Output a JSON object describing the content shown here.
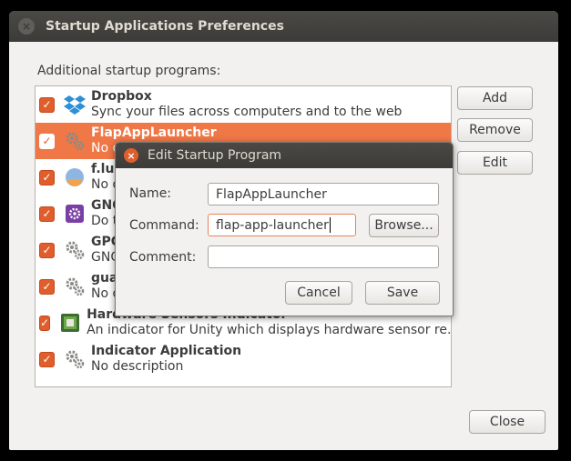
{
  "window": {
    "title": "Startup Applications Preferences",
    "close_glyph": "×"
  },
  "section_label": "Additional startup programs:",
  "list": {
    "items": [
      {
        "name": "Dropbox",
        "desc": "Sync your files across computers and to the web",
        "icon": "dropbox-icon",
        "checked": true
      },
      {
        "name": "FlapAppLauncher",
        "desc": "No d",
        "icon": "gear-icon",
        "checked": true,
        "selected": true
      },
      {
        "name": "f.lux",
        "desc": "No d",
        "icon": "flux-icon",
        "checked": true
      },
      {
        "name": "GNO",
        "desc": "Do th",
        "icon": "purple-gear-icon",
        "checked": true
      },
      {
        "name": "GPG",
        "desc": "GNO",
        "icon": "gear-icon",
        "checked": true
      },
      {
        "name": "guak",
        "desc": "No d",
        "icon": "gear-icon",
        "checked": true
      },
      {
        "name": "Hardware Sensors Indicator",
        "desc": "An indicator for Unity which displays hardware sensor re...",
        "icon": "sensor-icon",
        "checked": true
      },
      {
        "name": "Indicator Application",
        "desc": "No description",
        "icon": "gear-icon",
        "checked": true
      }
    ]
  },
  "buttons": {
    "add": "Add",
    "remove": "Remove",
    "edit": "Edit",
    "close": "Close"
  },
  "dialog": {
    "title": "Edit Startup Program",
    "close_glyph": "×",
    "name_label": "Name:",
    "name_value": "FlapAppLauncher",
    "command_label": "Command:",
    "command_value": "flap-app-launcher",
    "comment_label": "Comment:",
    "comment_value": "",
    "browse_label": "Browse...",
    "cancel_label": "Cancel",
    "save_label": "Save"
  },
  "colors": {
    "accent": "#f07746",
    "titlebar": "#3c3b37",
    "checkbox": "#e05e2c"
  },
  "checkmark": "✓"
}
